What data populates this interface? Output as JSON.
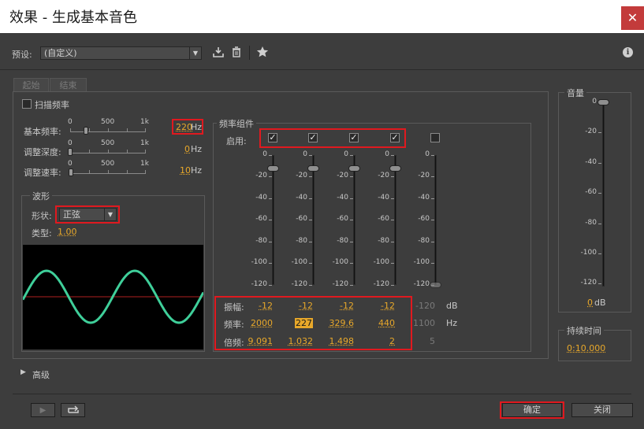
{
  "window": {
    "title": "效果 - 生成基本音色",
    "close_glyph": "✕"
  },
  "toolbar": {
    "preset_label": "预设:",
    "preset_value": "(自定义)",
    "info_glyph": "ℹ"
  },
  "tabs": [
    {
      "label": "起始"
    },
    {
      "label": "结束"
    }
  ],
  "sweep": {
    "label": "扫描频率"
  },
  "sliders": {
    "ruler_labels": [
      "0",
      "500",
      "1k"
    ],
    "base_freq": {
      "label": "基本频率:",
      "value": "220",
      "unit": "Hz"
    },
    "mod_depth": {
      "label": "调整深度:",
      "value": "0",
      "unit": "Hz"
    },
    "mod_rate": {
      "label": "调整速率:",
      "value": "10",
      "unit": "Hz"
    }
  },
  "waveform": {
    "title": "波形",
    "shape_label": "形状:",
    "shape_value": "正弦",
    "type_label": "类型:",
    "type_value": "1.00"
  },
  "freq_components": {
    "title": "频率组件",
    "enable_label": "启用:",
    "scale_labels": [
      "0",
      "-20",
      "-40",
      "-60",
      "-80",
      "-100",
      "-120"
    ],
    "row_labels": {
      "amplitude": "振幅:",
      "frequency": "频率:",
      "multiplier": "倍频:"
    },
    "units": {
      "amplitude": "dB",
      "frequency": "Hz"
    },
    "components": [
      {
        "enabled": true,
        "amplitude": "-12",
        "frequency": "2000",
        "multiplier": "9.091"
      },
      {
        "enabled": true,
        "amplitude": "-12",
        "frequency": "227",
        "multiplier": "1.032"
      },
      {
        "enabled": true,
        "amplitude": "-12",
        "frequency": "329.6",
        "multiplier": "1.498"
      },
      {
        "enabled": true,
        "amplitude": "-12",
        "frequency": "440",
        "multiplier": "2"
      },
      {
        "enabled": false,
        "amplitude": "-120",
        "frequency": "1100",
        "multiplier": "5"
      }
    ]
  },
  "volume": {
    "title": "音量",
    "scale_labels": [
      "0",
      "-20",
      "-40",
      "-60",
      "-80",
      "-100",
      "-120"
    ],
    "value": "0",
    "unit": "dB"
  },
  "duration": {
    "title": "持续时间",
    "value": "0:10.000"
  },
  "advanced": {
    "label": "高级"
  },
  "footer": {
    "ok_label": "确定",
    "close_label": "关闭"
  },
  "colors": {
    "accent": "#e8a82a",
    "highlight": "#e0191f",
    "wave": "#3fcf9a"
  }
}
